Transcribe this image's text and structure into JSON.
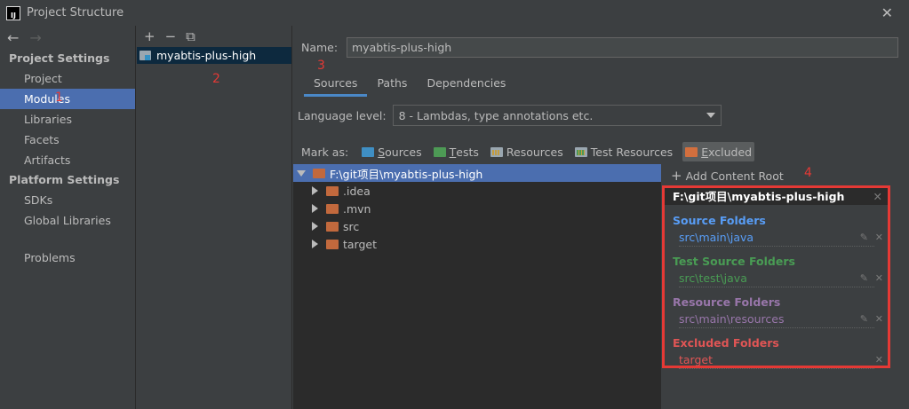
{
  "window": {
    "title": "Project Structure",
    "icon_text": "IJ"
  },
  "nav": {
    "back_icon": "arrow-left-icon",
    "forward_icon": "arrow-right-icon",
    "sections": [
      {
        "title": "Project Settings",
        "items": [
          "Project",
          "Modules",
          "Libraries",
          "Facets",
          "Artifacts"
        ]
      },
      {
        "title": "Platform Settings",
        "items": [
          "SDKs",
          "Global Libraries"
        ]
      }
    ],
    "problems": "Problems",
    "selected": "Modules"
  },
  "annotations": {
    "a1": "1",
    "a2": "2",
    "a3": "3",
    "a4": "4"
  },
  "modules": {
    "toolbar": {
      "add": "+",
      "remove": "−",
      "copy": "⧉"
    },
    "items": [
      "myabtis-plus-high"
    ]
  },
  "detail": {
    "name_label": "Name:",
    "name_value": "myabtis-plus-high",
    "tabs": [
      "Sources",
      "Paths",
      "Dependencies"
    ],
    "active_tab": "Sources",
    "language_label": "Language level:",
    "language_value": "8 - Lambdas, type annotations etc.",
    "mark_as_label": "Mark as:",
    "mark_buttons": [
      {
        "label": "Sources",
        "underline": "S",
        "rest": "ources"
      },
      {
        "label": "Tests",
        "underline": "T",
        "rest": "ests"
      },
      {
        "label": "Resources",
        "underline": "",
        "rest": "Resources"
      },
      {
        "label": "Test Resources",
        "underline": "",
        "rest": "Test Resources"
      },
      {
        "label": "Excluded",
        "underline": "E",
        "rest": "xcluded"
      }
    ]
  },
  "tree": {
    "root": "F:\\git项目\\myabtis-plus-high",
    "children": [
      ".idea",
      ".mvn",
      "src",
      "target"
    ]
  },
  "roots": {
    "add_label": "Add Content Root",
    "header": "F:\\git项目\\myabtis-plus-high",
    "groups": [
      {
        "title": "Source Folders",
        "color": "#589df6",
        "path": "src\\main\\java",
        "editable": true
      },
      {
        "title": "Test Source Folders",
        "color": "#499c54",
        "path": "src\\test\\java",
        "editable": true
      },
      {
        "title": "Resource Folders",
        "color": "#9876aa",
        "path": "src\\main\\resources",
        "editable": true
      },
      {
        "title": "Excluded Folders",
        "color": "#e05555",
        "path": "target",
        "editable": false
      }
    ]
  },
  "colors": {
    "accent": "#4b6eaf",
    "annotation": "#e53935"
  }
}
